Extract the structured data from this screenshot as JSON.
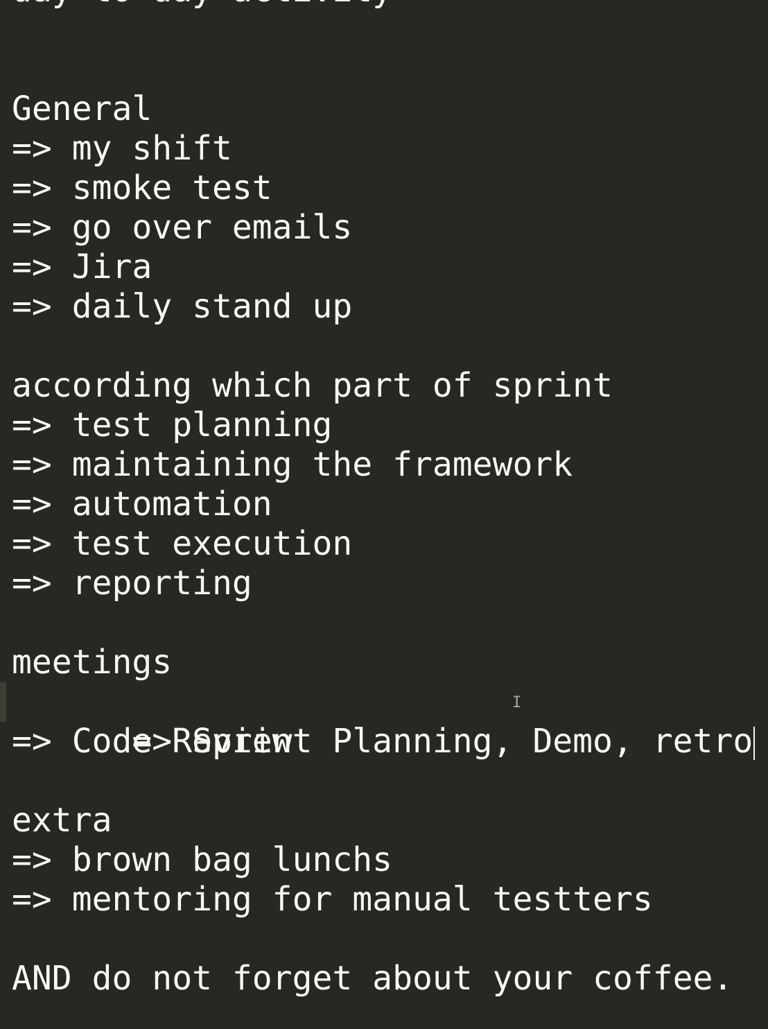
{
  "document": {
    "lines": [
      "day to day activity",
      "",
      "",
      "General",
      "=> my shift",
      "=> smoke test",
      "=> go over emails",
      "=> Jira",
      "=> daily stand up",
      "",
      "according which part of sprint",
      "=> test planning",
      "=> maintaining the framework",
      "=> automation",
      "=> test execution",
      "=> reporting",
      "",
      "meetings",
      "=> Sprint Planning, Demo, retro",
      "=> Code Review",
      "",
      "extra",
      "=> brown bag lunchs",
      "=> mentoring for manual testters",
      "",
      "AND do not forget about your coffee."
    ]
  },
  "colors": {
    "background": "#272822",
    "text": "#f8f8f2",
    "current_line_marker": "#3e3d32"
  },
  "cursor": {
    "line_index": 18,
    "pointer_glyph": "I"
  }
}
